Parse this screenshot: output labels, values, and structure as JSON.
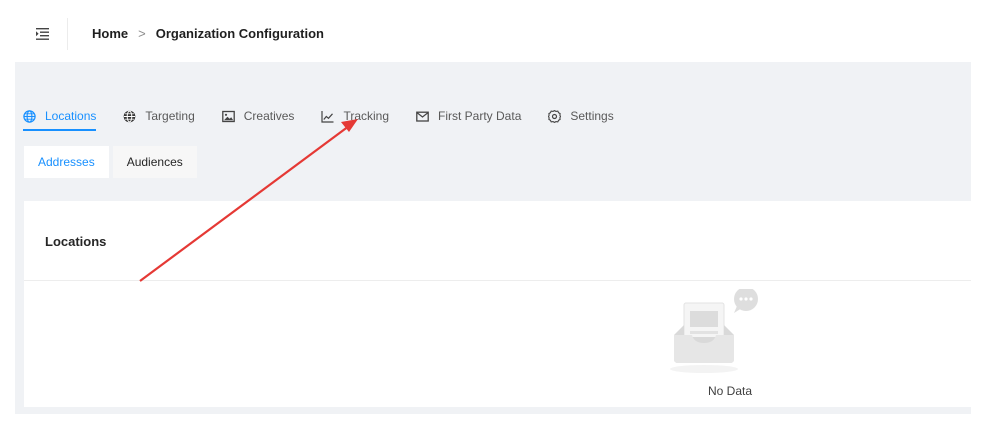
{
  "header": {
    "menu_icon": "menu-fold-icon",
    "breadcrumb": {
      "home": "Home",
      "separator": ">",
      "current": "Organization Configuration"
    }
  },
  "tabs": [
    {
      "label": "Locations",
      "icon": "globe-icon",
      "active": true
    },
    {
      "label": "Targeting",
      "icon": "globe-icon",
      "active": false
    },
    {
      "label": "Creatives",
      "icon": "image-icon",
      "active": false
    },
    {
      "label": "Tracking",
      "icon": "line-chart-icon",
      "active": false
    },
    {
      "label": "First Party Data",
      "icon": "mail-icon",
      "active": false
    },
    {
      "label": "Settings",
      "icon": "gear-icon",
      "active": false
    }
  ],
  "subtabs": [
    {
      "label": "Addresses",
      "active": true
    },
    {
      "label": "Audiences",
      "active": false
    }
  ],
  "card": {
    "title": "Locations",
    "empty_text": "No Data",
    "empty_icon": "empty-inbox-icon"
  },
  "annotation": {
    "type": "arrow",
    "color": "#e53935",
    "target": "Tracking"
  },
  "colors": {
    "accent": "#1890ff",
    "background": "#f0f2f5",
    "annotation": "#e53935"
  }
}
